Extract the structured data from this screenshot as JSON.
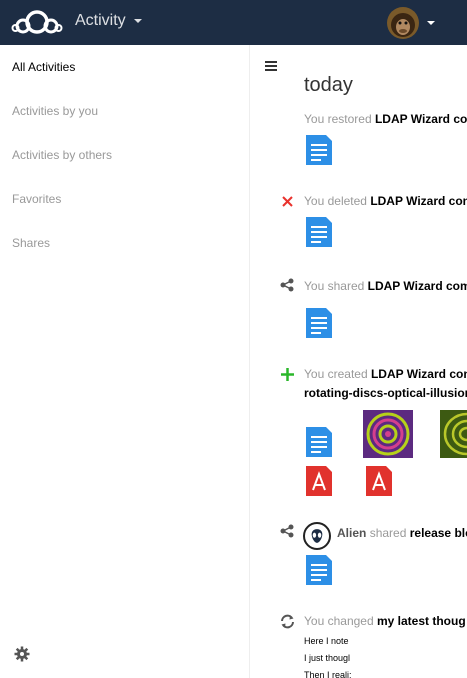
{
  "header": {
    "app_name": "Activity",
    "logo_icon": "cloud-logo-icon",
    "bg_color": "#1d2d44"
  },
  "sidebar": {
    "items": [
      {
        "label": "All Activities",
        "active": true
      },
      {
        "label": "Activities by you",
        "active": false
      },
      {
        "label": "Activities by others",
        "active": false
      },
      {
        "label": "Favorites",
        "active": false
      },
      {
        "label": "Shares",
        "active": false
      }
    ],
    "settings_icon": "gear-icon"
  },
  "stream": {
    "toggle_icon": "hamburger-icon",
    "day": "today",
    "activities": [
      {
        "icon": "restore-icon",
        "user": "You",
        "verb": "restored",
        "object": "LDAP Wizard co"
      },
      {
        "icon": "delete-icon",
        "user": "You",
        "verb": "deleted",
        "object": "LDAP Wizard con"
      },
      {
        "icon": "share-icon",
        "user": "You",
        "verb": "shared",
        "object": "LDAP Wizard com"
      },
      {
        "icon": "add-icon",
        "user": "You",
        "verb": "created",
        "object": "LDAP Wizard con",
        "object2": "rotating-discs-optical-illusion"
      },
      {
        "icon": "share-icon",
        "user": "Alien",
        "verb": "shared",
        "object": "release blo"
      },
      {
        "icon": "change-icon",
        "user": "You",
        "verb": "changed",
        "object": "my latest thoug",
        "lines": [
          "Here I note",
          "I just thougl",
          "Then I reali:"
        ]
      }
    ]
  }
}
